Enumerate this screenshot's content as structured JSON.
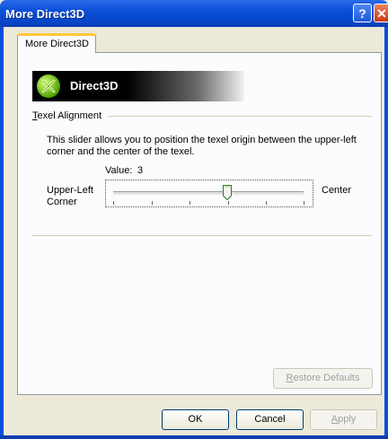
{
  "window": {
    "title": "More Direct3D"
  },
  "tabs": [
    {
      "label": "More Direct3D"
    }
  ],
  "banner": {
    "text": "Direct3D"
  },
  "texel": {
    "group_title_first": "T",
    "group_title_rest": "exel Alignment",
    "description": "This slider allows you to position the texel origin between the upper-left corner and the center of the texel.",
    "value_label": "Value:",
    "value": "3",
    "left_label": "Upper-Left Corner",
    "right_label": "Center",
    "slider_position": 0.6
  },
  "buttons": {
    "restore_first": "R",
    "restore_rest": "estore Defaults",
    "ok": "OK",
    "cancel": "Cancel",
    "apply_first": "A",
    "apply_rest": "pply"
  }
}
